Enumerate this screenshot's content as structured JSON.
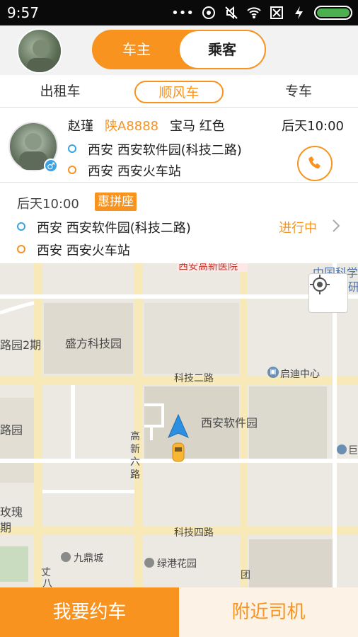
{
  "status_bar": {
    "time": "9:57",
    "icons": [
      "more-icon",
      "ring-icon",
      "mute-icon",
      "wifi-icon",
      "sim-icon",
      "charging-icon",
      "battery-icon"
    ]
  },
  "header": {
    "segments": {
      "owner": "车主",
      "passenger": "乘客"
    },
    "selected": "乘客"
  },
  "tabs": [
    {
      "label": "出租车"
    },
    {
      "label": "顺风车",
      "selected": true
    },
    {
      "label": "专车"
    }
  ],
  "driver": {
    "name": "赵瑾",
    "plate": "陕A8888",
    "car": "宝马 红色",
    "time": "后天10:00",
    "from": "西安 西安软件园(科技二路)",
    "to": "西安 西安火车站",
    "gender": "♂"
  },
  "order": {
    "time": "后天10:00",
    "badge": "惠拼座",
    "from": "西安 西安软件园(科技二路)",
    "to": "西安 西安火车站",
    "status": "进行中"
  },
  "map": {
    "labels": {
      "hospital": "西安高新医院",
      "zhongguo": "中国科学",
      "zhongguo2": "球环境研",
      "shengfang": "盛方科技园",
      "luyuan2": "路园2期",
      "qidi": "启迪中心",
      "keji2": "科技二路",
      "software": "西安软件园",
      "luyuan": "路园",
      "gaoxin6": "高新六路",
      "xmeigui": "玫瑰",
      "qi": "期",
      "keji4": "科技四路",
      "jiuding": "九鼎城",
      "lvgang": "绿港花园",
      "tuan": "团",
      "zhang": "丈",
      "ba": "八",
      "ju": "巨"
    }
  },
  "colors": {
    "accent": "#f7931e",
    "blue": "#3aa3e3"
  },
  "bottom": {
    "book": "我要约车",
    "nearby": "附近司机"
  }
}
